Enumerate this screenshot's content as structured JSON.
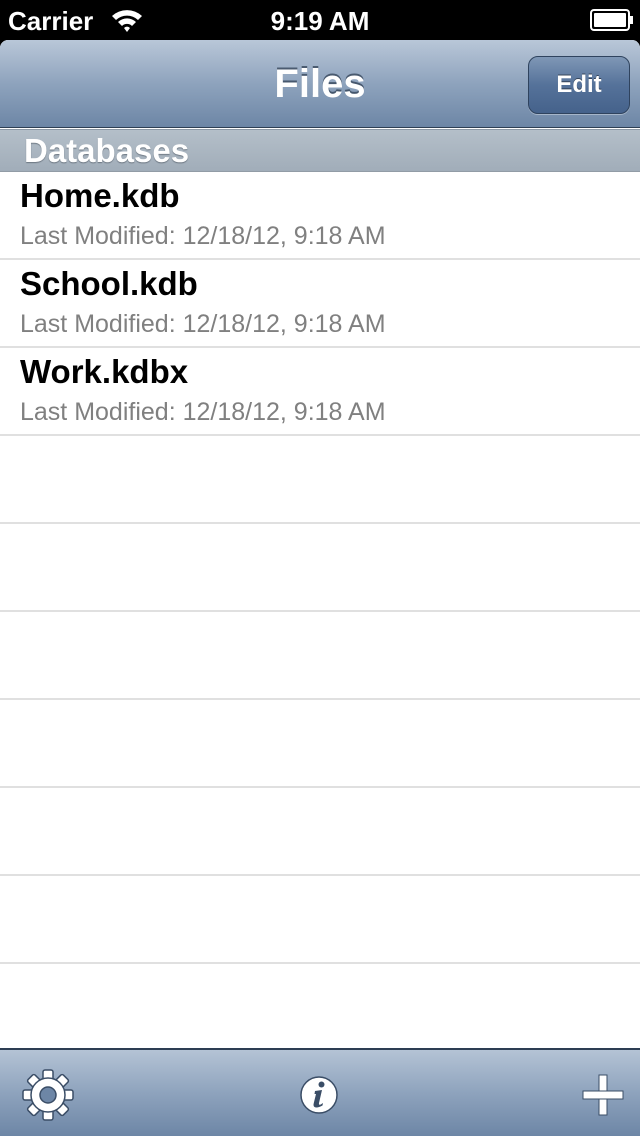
{
  "status_bar": {
    "carrier": "Carrier",
    "time": "9:19 AM"
  },
  "navbar": {
    "title": "Files",
    "edit_label": "Edit"
  },
  "section": {
    "title": "Databases"
  },
  "files": [
    {
      "name": "Home.kdb",
      "detail": "Last Modified: 12/18/12, 9:18 AM"
    },
    {
      "name": "School.kdb",
      "detail": "Last Modified: 12/18/12, 9:18 AM"
    },
    {
      "name": "Work.kdbx",
      "detail": "Last Modified: 12/18/12, 9:18 AM"
    }
  ],
  "toolbar": {
    "icons": [
      "gear-icon",
      "info-icon",
      "plus-icon"
    ]
  },
  "colors": {
    "nav_blue": "#6d86a6",
    "edit_button": "#55729a",
    "detail_gray": "#808080"
  }
}
